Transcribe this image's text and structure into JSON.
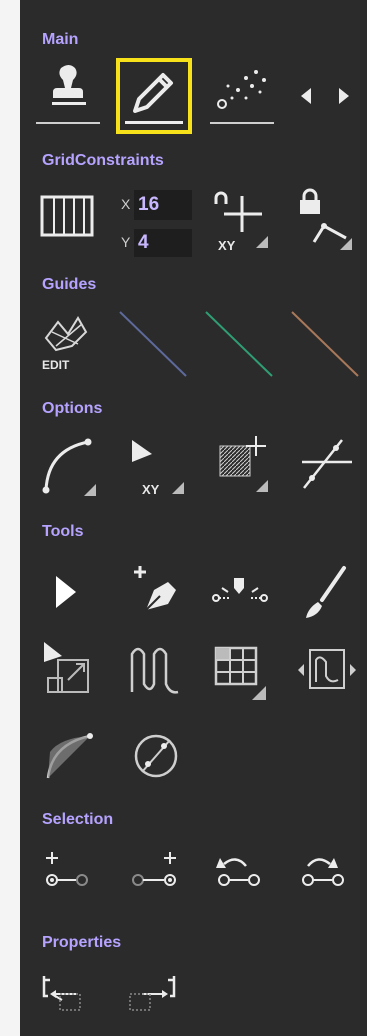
{
  "sections": {
    "main": "Main",
    "grid": "GridConstraints",
    "guides": "Guides",
    "options": "Options",
    "tools": "Tools",
    "selection": "Selection",
    "properties": "Properties"
  },
  "grid": {
    "x_label": "X",
    "x_value": "16",
    "y_label": "Y",
    "y_value": "4",
    "snap_label": "XY"
  },
  "guides": {
    "edit_label": "EDIT"
  },
  "options": {
    "xy_label": "XY"
  },
  "colors": {
    "panel": "#2b2b2b",
    "header": "#b6a3ff",
    "selected_outline": "#f7e11b",
    "guide_blue": "#5e6a9c",
    "guide_green": "#2f9e74",
    "guide_orange": "#a8785a"
  },
  "icons": {
    "main": [
      "stamp-icon",
      "pencil-icon",
      "spray-icon",
      "arrow-left-icon",
      "arrow-right-icon"
    ],
    "grid": [
      "grid-icon",
      "snap-xy-icon",
      "lock-curve-icon"
    ],
    "guides": [
      "guide-edit-icon",
      "guide-blue-line",
      "guide-green-line",
      "guide-orange-line"
    ],
    "options": [
      "curve-icon",
      "pointer-xy-icon",
      "hatch-select-icon",
      "line-intersect-icon"
    ],
    "tools": [
      "select-arrow-icon",
      "pen-add-icon",
      "node-drop-icon",
      "brush-icon",
      "transform-icon",
      "wave-icon",
      "table-icon",
      "frame-wave-icon",
      "curve-tool-icon",
      "circle-diagonal-icon"
    ],
    "selection": [
      "add-left-node-icon",
      "add-right-node-icon",
      "undo-node-icon",
      "redo-node-icon"
    ],
    "properties": [
      "move-left-icon",
      "move-right-icon"
    ]
  }
}
